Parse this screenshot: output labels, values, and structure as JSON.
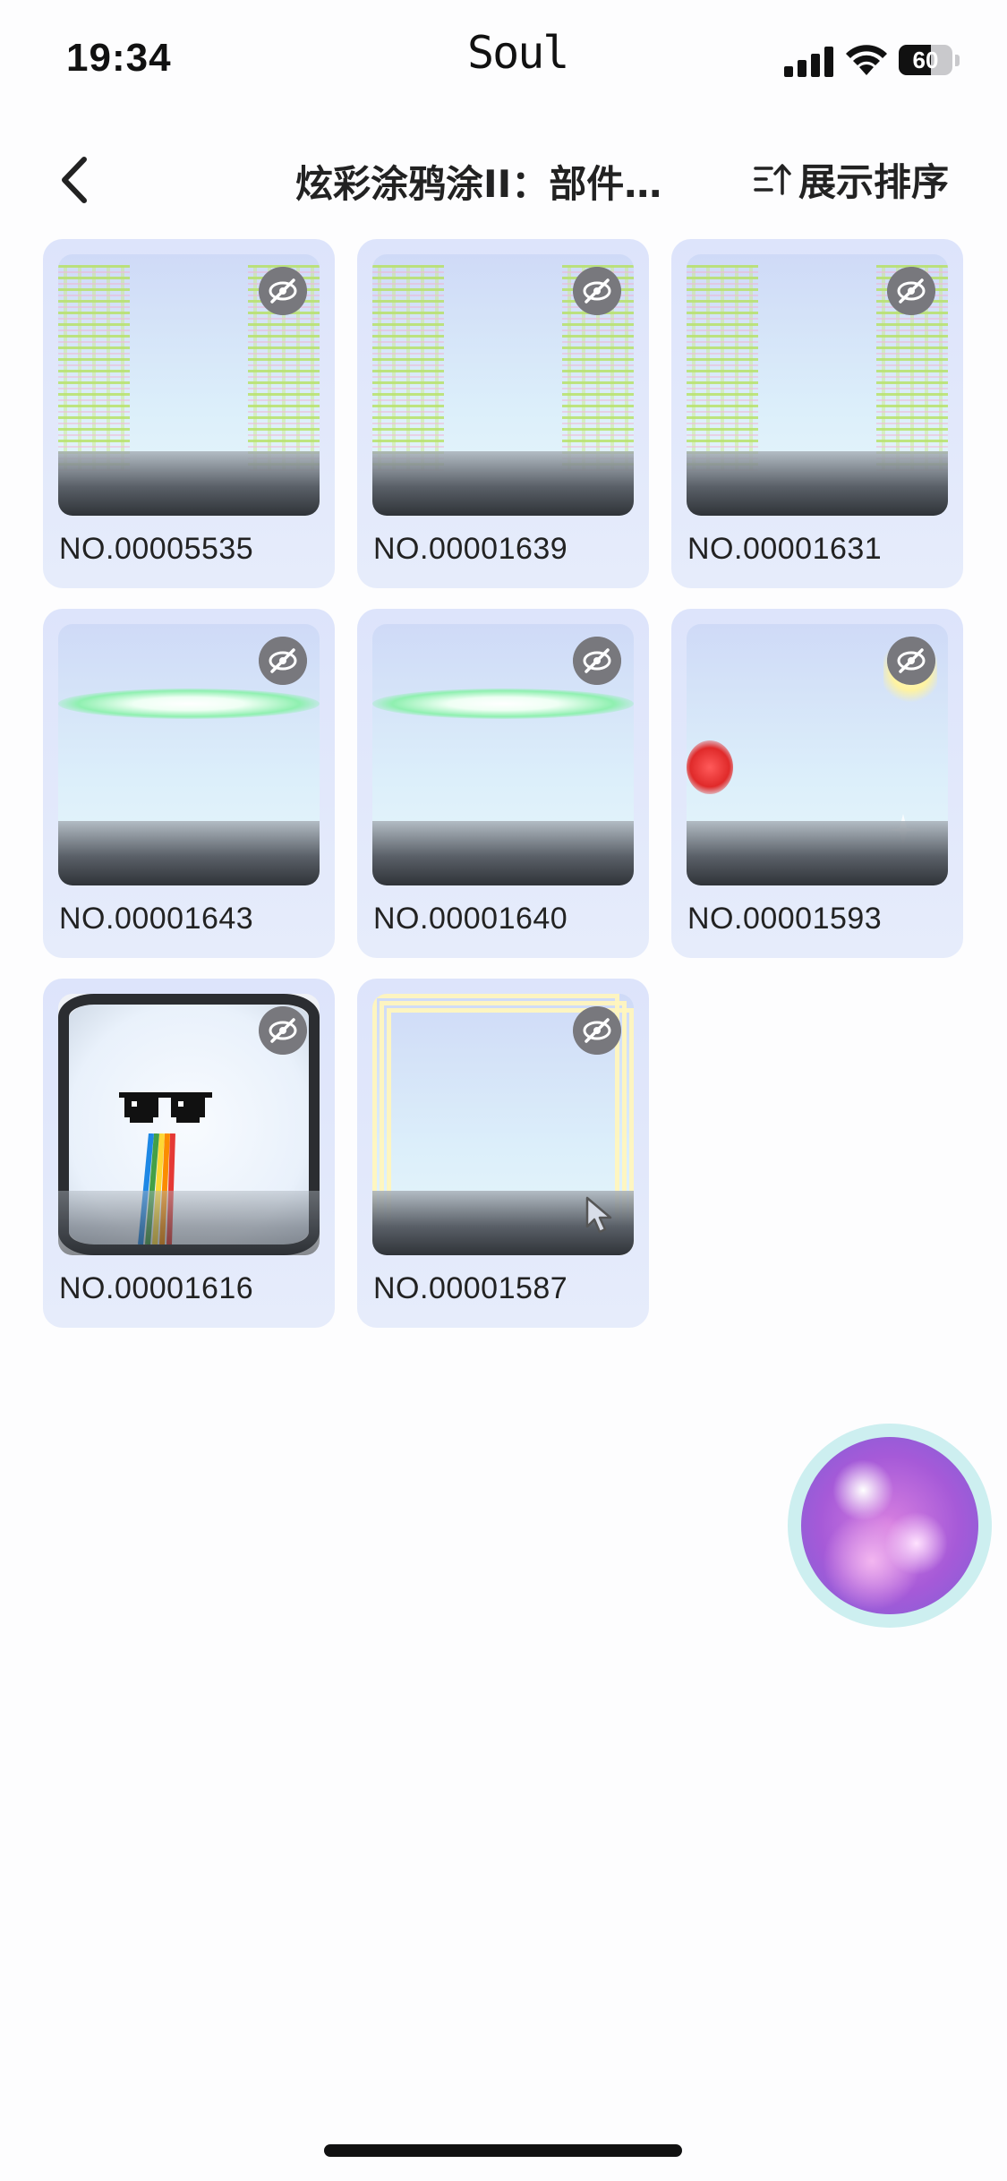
{
  "status_bar": {
    "time": "19:34",
    "app_name": "Soul",
    "battery_level": "60",
    "battery_fraction": 0.6
  },
  "nav": {
    "title": "炫彩涂鸦涂II：部件…",
    "sort_label": "展示排序",
    "icons": {
      "back": "chevron-left-icon",
      "sort": "sort-icon"
    }
  },
  "items": [
    {
      "label": "NO.00005535",
      "thumb": "glitch",
      "hidden_icon": "eye-off-icon"
    },
    {
      "label": "NO.00001639",
      "thumb": "glitch",
      "hidden_icon": "eye-off-icon"
    },
    {
      "label": "NO.00001631",
      "thumb": "glitch",
      "hidden_icon": "eye-off-icon"
    },
    {
      "label": "NO.00001643",
      "thumb": "halo",
      "hidden_icon": "eye-off-icon"
    },
    {
      "label": "NO.00001640",
      "thumb": "halo",
      "hidden_icon": "eye-off-icon"
    },
    {
      "label": "NO.00001593",
      "thumb": "fx",
      "hidden_icon": "eye-off-icon"
    },
    {
      "label": "NO.00001616",
      "thumb": "tv",
      "hidden_icon": "eye-off-icon"
    },
    {
      "label": "NO.00001587",
      "thumb": "frames",
      "hidden_icon": "eye-off-icon"
    }
  ],
  "colors": {
    "card_bg": "#dde4fb",
    "badge_bg": "#78787d",
    "text": "#222222"
  }
}
